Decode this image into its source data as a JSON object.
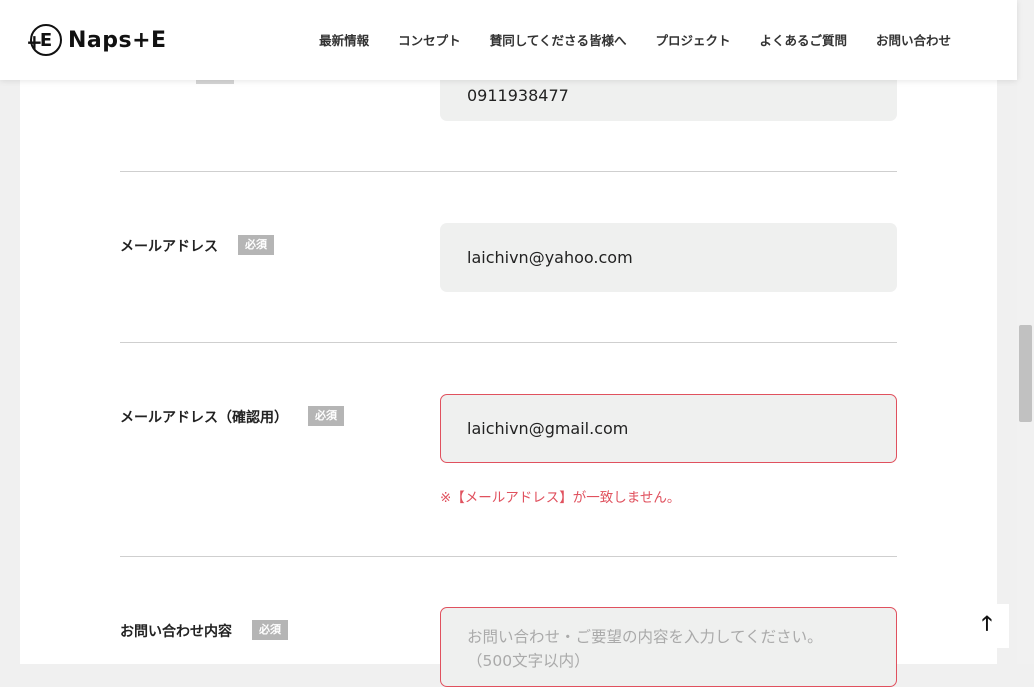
{
  "brand": {
    "name": "Naps+E"
  },
  "nav": [
    {
      "label": "最新情報"
    },
    {
      "label": "コンセプト"
    },
    {
      "label": "賛同してくださる皆様へ"
    },
    {
      "label": "プロジェクト"
    },
    {
      "label": "よくあるご質問"
    },
    {
      "label": "お問い合わせ"
    }
  ],
  "form": {
    "phone": {
      "value": "0911938477"
    },
    "email": {
      "label": "メールアドレス",
      "required": "必須",
      "value": "laichivn@yahoo.com"
    },
    "email_confirm": {
      "label": "メールアドレス（確認用）",
      "required": "必須",
      "value": "laichivn@gmail.com",
      "error": "※【メールアドレス】が一致しません。"
    },
    "inquiry": {
      "label": "お問い合わせ内容",
      "required": "必須",
      "placeholder_line1": "お問い合わせ・ご要望の内容を入力してください。",
      "placeholder_line2": "（500文字以内）"
    }
  },
  "back_to_top": {
    "icon": "arrow-up-icon",
    "glyph": "🡑"
  },
  "colors": {
    "error": "#e0515e",
    "badge": "#b5b5b5",
    "input_bg": "#eff0ef"
  }
}
